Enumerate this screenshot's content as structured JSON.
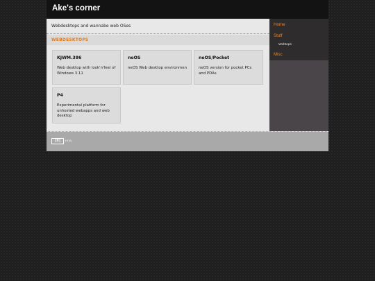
{
  "header": {
    "title": "Ake's corner"
  },
  "main": {
    "tagline": "Webdesktops and wannabe web OSes",
    "section_title": "WEBDESKTOPS",
    "cards": [
      {
        "title": "KJWM.386",
        "desc": "Web desktop with look'n'feel of Windows 3.11"
      },
      {
        "title": "neOS",
        "desc": "neOS Web desktop environmen"
      },
      {
        "title": "neOS/Pocket",
        "desc": "neOS version for pocket PCs and PDAs"
      },
      {
        "title": "P4",
        "desc": "Experimental platform for unhosted webapps and web desktop"
      }
    ]
  },
  "sidebar": {
    "items": [
      {
        "label": "Home"
      },
      {
        "label": "Stuff"
      },
      {
        "label": "Webtops"
      },
      {
        "label": "Misc"
      }
    ]
  },
  "footer": {
    "badge_mark": "[H]",
    "badge_text": "HTML"
  },
  "colors": {
    "accent": "#e68a2e",
    "header_bg": "#131313",
    "sidebar_bg": "#4a4548"
  }
}
